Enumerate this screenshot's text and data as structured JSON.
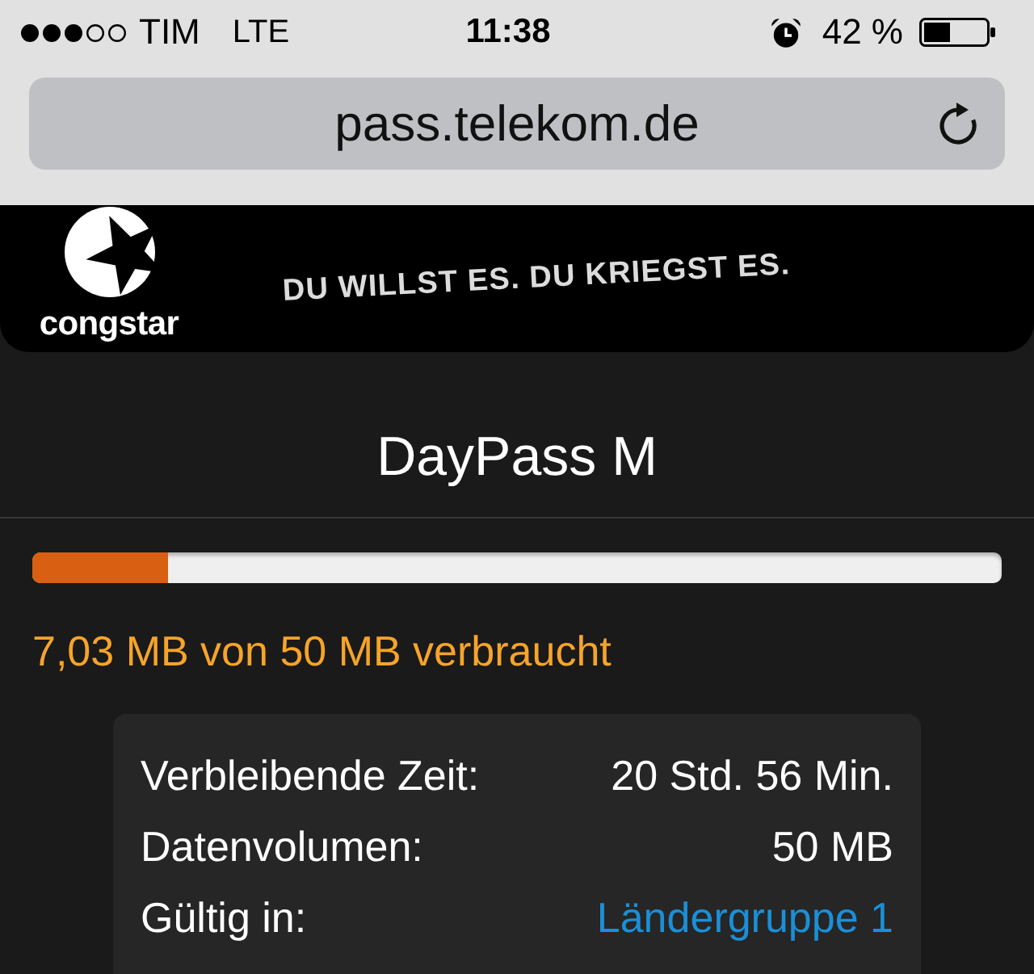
{
  "status_bar": {
    "carrier": "TIM",
    "network": "LTE",
    "time": "11:38",
    "battery": "42 %"
  },
  "address_bar": {
    "url": "pass.telekom.de"
  },
  "banner": {
    "brand": "congstar",
    "slogan": "DU WILLST ES. DU KRIEGST ES."
  },
  "pass": {
    "title": "DayPass M",
    "usage": {
      "level": 0.14,
      "text": "7,03 MB von 50 MB verbraucht"
    },
    "details": [
      {
        "label": "Verbleibende Zeit:",
        "value": "20 Std. 56 Min.",
        "kind": "text"
      },
      {
        "label": "Datenvolumen:",
        "value": "50 MB",
        "kind": "text"
      },
      {
        "label": "Gültig in:",
        "value": "Ländergruppe 1",
        "kind": "link"
      }
    ]
  }
}
